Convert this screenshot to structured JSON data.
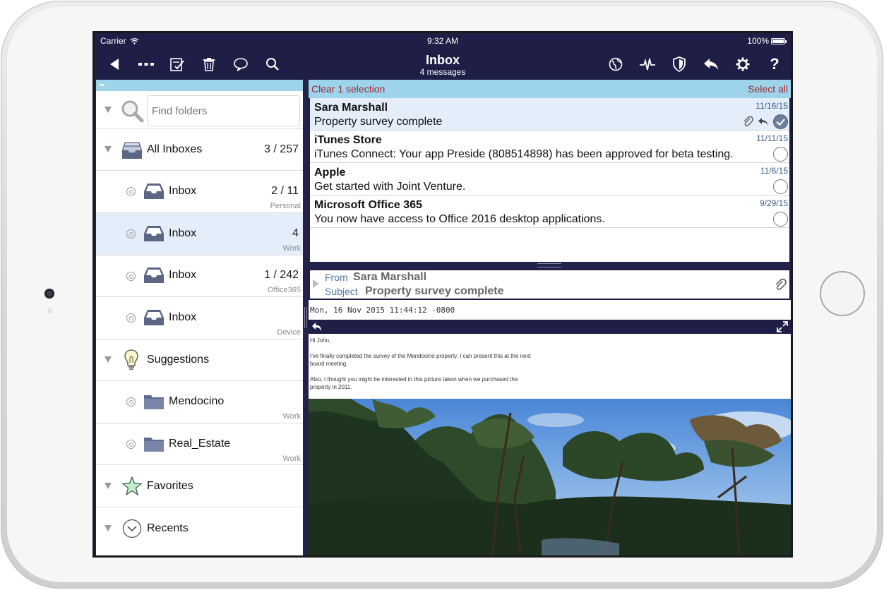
{
  "status_bar": {
    "carrier": "Carrier",
    "time": "9:32 AM",
    "battery": "100%"
  },
  "toolbar": {
    "title": "Inbox",
    "subtitle": "4 messages",
    "left_icons": [
      "back-icon",
      "more-icon",
      "compose-icon",
      "trash-icon",
      "comment-icon",
      "search-icon"
    ],
    "right_icons": [
      "globe-icon",
      "activity-icon",
      "shield-icon",
      "reply-icon",
      "gear-icon",
      "help-icon"
    ],
    "help_glyph": "?"
  },
  "sidebar": {
    "search_placeholder": "Find folders",
    "all_inboxes": {
      "label": "All Inboxes",
      "count": "3 / 257"
    },
    "inboxes": [
      {
        "label": "Inbox",
        "count": "2 / 11",
        "account": "Personal"
      },
      {
        "label": "Inbox",
        "count": "4",
        "account": "Work"
      },
      {
        "label": "Inbox",
        "count": "1 / 242",
        "account": "Office365"
      },
      {
        "label": "Inbox",
        "count": "",
        "account": "Device"
      }
    ],
    "suggestions": {
      "label": "Suggestions"
    },
    "folders": [
      {
        "label": "Mendocino",
        "account": "Work"
      },
      {
        "label": "Real_Estate",
        "account": "Work"
      }
    ],
    "favorites": {
      "label": "Favorites"
    },
    "recents": {
      "label": "Recents"
    }
  },
  "selection_bar": {
    "clear": "Clear 1 selection",
    "select_all": "Select all"
  },
  "messages": [
    {
      "from": "Sara Marshall",
      "subject": "Property survey complete",
      "date": "11/16/15",
      "selected": true
    },
    {
      "from": "iTunes Store",
      "subject": "iTunes Connect: Your app Preside (808514898) has been approved for beta testing.",
      "date": "11/11/15",
      "selected": false
    },
    {
      "from": "Apple",
      "subject": "Get started with Joint Venture.",
      "date": "11/6/15",
      "selected": false
    },
    {
      "from": "Microsoft Office 365",
      "subject": "You now have access to Office 2016 desktop applications.",
      "date": "9/29/15",
      "selected": false
    }
  ],
  "message_header": {
    "from_label": "From",
    "from_value": "Sara Marshall",
    "subject_label": "Subject",
    "subject_value": "Property survey complete"
  },
  "message_date": "Mon, 16 Nov 2015 11:44:12 -0800",
  "message_body": {
    "greeting": "Hi John,",
    "para1_line1": "I've finally completed the survey of the Mendocino property.  I can present this at the next",
    "para1_line2": "board meeting.",
    "para2_line1": "Also, I thought you might be interested in this picture taken when we purchased the",
    "para2_line2": "property in 2011."
  },
  "colors": {
    "nav": "#1e1e46",
    "selection_bar": "#9dd3eb",
    "selected_row": "#e4eefa",
    "clear_text": "#a0282e",
    "header_label": "#4f77a8"
  }
}
